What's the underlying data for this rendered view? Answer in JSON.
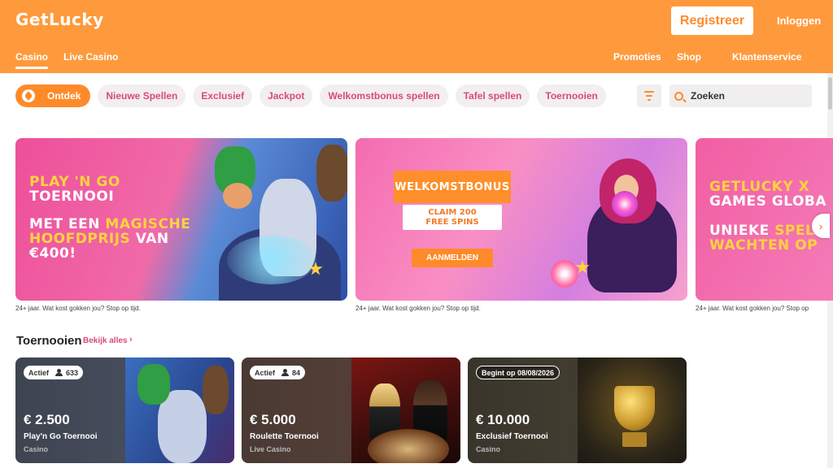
{
  "header": {
    "logo": "GetLucky",
    "register_label": "Registreer",
    "login_label": "Inloggen",
    "nav_left": [
      "Casino",
      "Live Casino"
    ],
    "nav_right": [
      "Promoties",
      "Shop",
      "Klantenservice"
    ]
  },
  "chips": [
    "Ontdek",
    "Nieuwe Spellen",
    "Exclusief",
    "Jackpot",
    "Welkomstbonus spellen",
    "Tafel spellen",
    "Toernooien"
  ],
  "search": {
    "placeholder": "Zoeken"
  },
  "banners": [
    {
      "line1": "PLAY 'N GO",
      "line2": "TOERNOOI",
      "line3a": "MET EEN ",
      "line3b": "MAGISCHE",
      "line4a": "HOOFDPRIJS",
      "line4b": " VAN",
      "line5": "€400!",
      "disclaimer": "24+ jaar. Wat kost gokken jou?  Stop op tijd."
    },
    {
      "title": "WELKOMSTBONUS",
      "claim_line1": "CLAIM 200",
      "claim_line2": "FREE SPINS",
      "cta": "AANMELDEN",
      "disclaimer": "24+ jaar. Wat kost gokken jou?  Stop op tijd."
    },
    {
      "line1": "GETLUCKY X",
      "line2": "GAMES GLOBA",
      "line3a": "UNIEKE ",
      "line3b": "SPEL",
      "line4": "WACHTEN OP",
      "disclaimer": "24+ jaar. Wat kost gokken jou?  Stop op"
    }
  ],
  "tournaments": {
    "title": "Toernooien",
    "view_all": "Bekijk alles",
    "cards": [
      {
        "status": "Actief",
        "players": "633",
        "prize": "€ 2.500",
        "name": "Play'n Go Toernooi",
        "category": "Casino"
      },
      {
        "status": "Actief",
        "players": "84",
        "prize": "€ 5.000",
        "name": "Roulette Toernooi",
        "category": "Live Casino"
      },
      {
        "status": "Begint op 08/08/2026",
        "prize": "€ 10.000",
        "name": "Exclusief Toernooi",
        "category": "Casino"
      }
    ]
  },
  "colors": {
    "brand": "#ff9a3c",
    "accent": "#d64b7d"
  }
}
